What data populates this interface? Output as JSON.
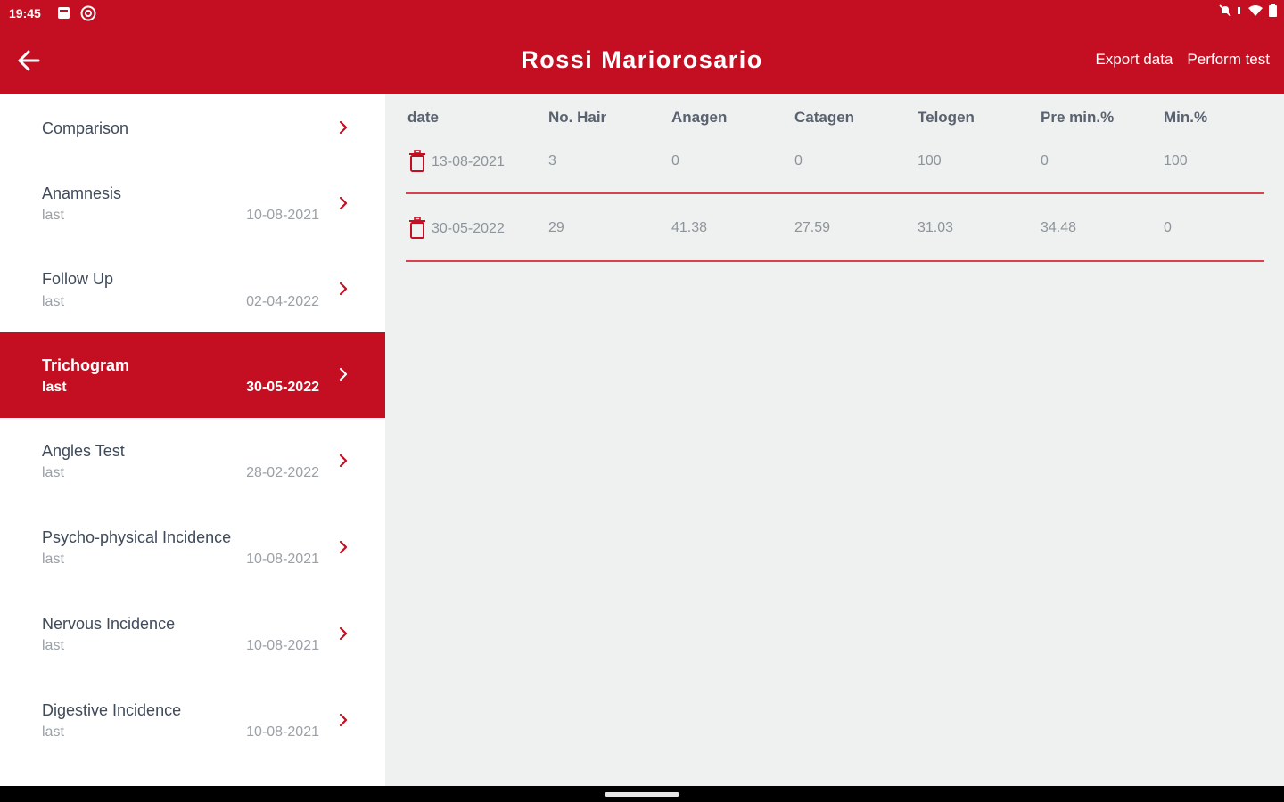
{
  "status_bar": {
    "time": "19:45",
    "left_icons": [
      "image-notification-icon",
      "at-sign-icon"
    ],
    "right_icons": [
      "mute-icon",
      "wifi-icon",
      "battery-icon"
    ]
  },
  "app_bar": {
    "title": "Rossi Mariorosario",
    "actions": {
      "export": "Export data",
      "perform": "Perform test"
    },
    "accent_color": "#c40f22"
  },
  "sidebar": {
    "items": [
      {
        "label": "Comparison"
      },
      {
        "label": "Anamnesis",
        "sub": "last",
        "date": "10-08-2021"
      },
      {
        "label": "Follow Up",
        "sub": "last",
        "date": "02-04-2022"
      },
      {
        "label": "Trichogram",
        "sub": "last",
        "date": "30-05-2022",
        "active": true
      },
      {
        "label": "Angles Test",
        "sub": "last",
        "date": "28-02-2022"
      },
      {
        "label": "Psycho-physical Incidence",
        "sub": "last",
        "date": "10-08-2021"
      },
      {
        "label": "Nervous Incidence",
        "sub": "last",
        "date": "10-08-2021"
      },
      {
        "label": "Digestive Incidence",
        "sub": "last",
        "date": "10-08-2021"
      }
    ]
  },
  "table": {
    "headers": [
      "date",
      "No. Hair",
      "Anagen",
      "Catagen",
      "Telogen",
      "Pre min.%",
      "Min.%"
    ],
    "rows": [
      [
        "13-08-2021",
        "3",
        "0",
        "0",
        "100",
        "0",
        "100"
      ],
      [
        "30-05-2022",
        "29",
        "41.38",
        "27.59",
        "31.03",
        "34.48",
        "0"
      ]
    ]
  }
}
